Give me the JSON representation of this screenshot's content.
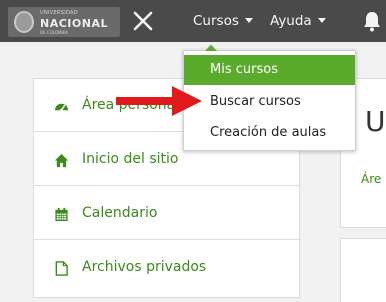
{
  "navbar": {
    "logo": {
      "line1": "UNIVERSIDAD",
      "line2": "NACIONAL",
      "line3": "DE COLOMBIA"
    },
    "menus": [
      {
        "label": "Cursos"
      },
      {
        "label": "Ayuda"
      }
    ],
    "background": "#4a4a4a"
  },
  "dropdown": {
    "items": [
      {
        "label": "Mis cursos",
        "active": true
      },
      {
        "label": "Buscar cursos",
        "active": false
      },
      {
        "label": "Creación de aulas",
        "active": false
      }
    ],
    "active_color": "#5aab2c"
  },
  "sidebar": {
    "items": [
      {
        "label": "Área personal",
        "icon": "dashboard-icon"
      },
      {
        "label": "Inicio del sitio",
        "icon": "home-icon"
      },
      {
        "label": "Calendario",
        "icon": "calendar-icon"
      },
      {
        "label": "Archivos privados",
        "icon": "file-icon"
      }
    ],
    "link_color": "#3a8a1c"
  },
  "main": {
    "title_fragment": "U",
    "breadcrumb_fragment": "Áre"
  },
  "annotation": {
    "arrow_color": "#e0191b"
  }
}
